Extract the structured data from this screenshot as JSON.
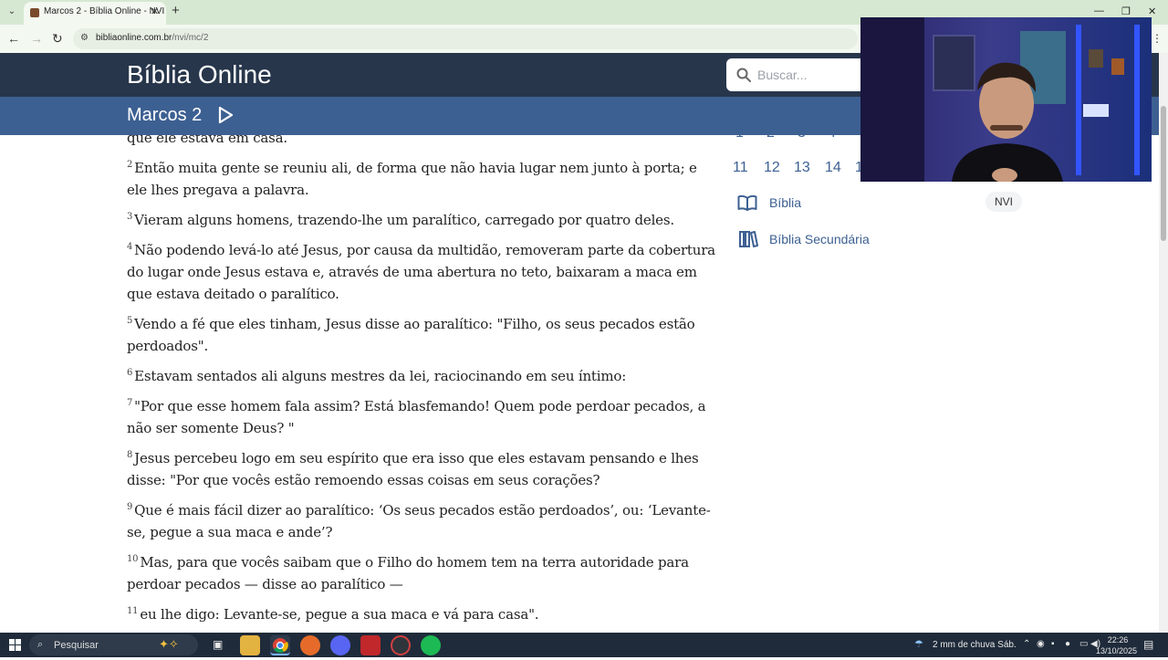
{
  "browser": {
    "tab_title": "Marcos 2 - Bíblia Online - NVI",
    "url_domain": "bibliaonline.com.br",
    "url_path": "/nvi/mc/2"
  },
  "site": {
    "title": "Bíblia Online",
    "search_placeholder": "Buscar...",
    "chapter_title": "Marcos 2"
  },
  "verses": [
    {
      "num": "",
      "text": "que ele estava em casa."
    },
    {
      "num": "2",
      "text": "Então muita gente se reuniu ali, de forma que não havia lugar nem junto à porta; e ele lhes pregava a palavra."
    },
    {
      "num": "3",
      "text": "Vieram alguns homens, trazendo-lhe um paralítico, carregado por quatro deles."
    },
    {
      "num": "4",
      "text": "Não podendo levá-lo até Jesus, por causa da multidão, removeram parte da cobertura do lugar onde Jesus estava e, através de uma abertura no teto, baixaram a maca em que estava deitado o paralítico."
    },
    {
      "num": "5",
      "text": "Vendo a fé que eles tinham, Jesus disse ao paralítico: \"Filho, os seus pecados estão perdoados\"."
    },
    {
      "num": "6",
      "text": "Estavam sentados ali alguns mestres da lei, raciocinando em seu íntimo:"
    },
    {
      "num": "7",
      "text": "\"Por que esse homem fala assim? Está blasfemando! Quem pode perdoar pecados, a não ser somente Deus? \""
    },
    {
      "num": "8",
      "text": "Jesus percebeu logo em seu espírito que era isso que eles estavam pensando e lhes disse: \"Por que vocês estão remoendo essas coisas em seus corações?"
    },
    {
      "num": "9",
      "text": "Que é mais fácil dizer ao paralítico: ‘Os seus pecados estão perdoados’, ou: ‘Levante-se, pegue a sua maca e ande’?"
    },
    {
      "num": "10",
      "text": "Mas, para que vocês saibam que o Filho do homem tem na terra autoridade para perdoar pecados — disse ao paralítico —"
    },
    {
      "num": "11",
      "text": "eu lhe digo: Levante-se, pegue a sua maca e vá para casa\"."
    }
  ],
  "sidebar": {
    "chapters_row_top": [
      "1",
      "2",
      "3",
      "4"
    ],
    "chapters_row": [
      "11",
      "12",
      "13",
      "14",
      "1"
    ],
    "bible_link": "Bíblia",
    "secondary_bible_link": "Bíblia Secundária",
    "version_badge": "NVI"
  },
  "taskbar": {
    "search_label": "Pesquisar",
    "weather": "2 mm de chuva Sáb.",
    "time": "22:26",
    "date": "13/10/2025"
  },
  "colors": {
    "header_dark": "#27364b",
    "chapter_bar": "#3d6092",
    "link": "#3d6092",
    "tab_bar": "#d7e8d2"
  }
}
